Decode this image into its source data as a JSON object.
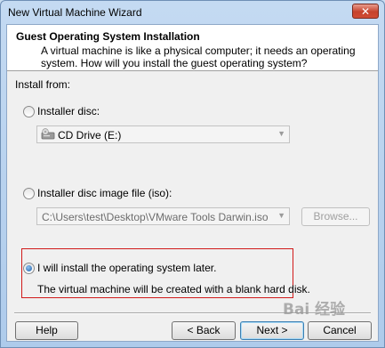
{
  "window": {
    "title": "New Virtual Machine Wizard",
    "close_glyph": "✕"
  },
  "header": {
    "title": "Guest Operating System Installation",
    "description": "A virtual machine is like a physical computer; it needs an operating system. How will you install the guest operating system?"
  },
  "install_from": {
    "label": "Install from:",
    "options": [
      {
        "label": "Installer disc:",
        "selected": false
      },
      {
        "label": "Installer disc image file (iso):",
        "selected": false
      },
      {
        "label": "I will install the operating system later.",
        "selected": true
      }
    ],
    "disc_drive_value": "CD Drive (E:)",
    "iso_path_value": "C:\\Users\\test\\Desktop\\VMware Tools Darwin.iso",
    "browse_label": "Browse...",
    "later_note": "The virtual machine will be created with a blank hard disk."
  },
  "footer": {
    "help_label": "Help",
    "back_label": "< Back",
    "next_label": "Next >",
    "cancel_label": "Cancel"
  },
  "watermark": "Bai 经验",
  "colors": {
    "highlight_border": "#d11a1a",
    "title_bar": "#c4daf2",
    "dialog_bg": "#f0f0f0"
  }
}
